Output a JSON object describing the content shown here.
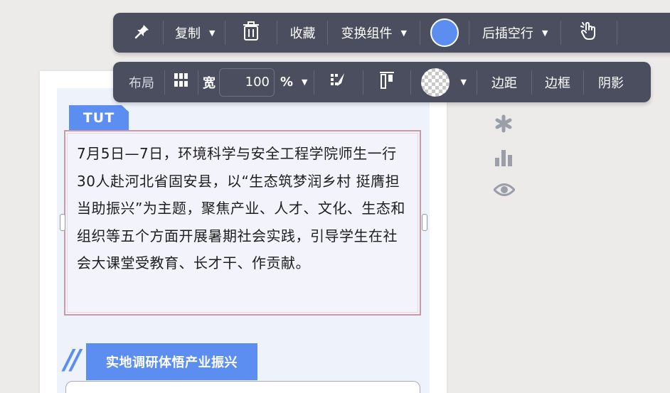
{
  "toolbar_top": {
    "copy_label": "复制",
    "collect_label": "收藏",
    "transform_label": "变换组件",
    "insert_label": "后插空行",
    "color": "#5b8ef0"
  },
  "toolbar_layout": {
    "layout_label": "布局",
    "width_label": "宽",
    "width_value": "100",
    "unit_label": "%",
    "margin_label": "边距",
    "border_label": "边框",
    "shadow_label": "阴影"
  },
  "content": {
    "badge": "TUT",
    "paragraph": "7月5日—7日，环境科学与安全工程学院师生一行30人赴河北省固安县，以“生态筑梦润乡村 挺膺担当助振兴”为主题，聚焦产业、人才、文化、生态和组织等五个方面开展暑期社会实践，引导学生在社会大课堂受教育、长才干、作贡献。",
    "section_deco": "//",
    "section_title": "实地调研体悟产业振兴"
  },
  "icons": {
    "pin": "pin-icon",
    "trash": "trash-icon",
    "touch": "touch-hand-icon",
    "grid": "grid-icon",
    "brush": "format-brush-icon",
    "align": "align-top-icon",
    "asterisk": "asterisk-icon",
    "bars": "bar-chart-icon",
    "eye": "eye-icon"
  },
  "colors": {
    "toolbar_bg": "#4a4e5e",
    "accent": "#5b8ef0",
    "card_bg": "#eef2fb"
  }
}
